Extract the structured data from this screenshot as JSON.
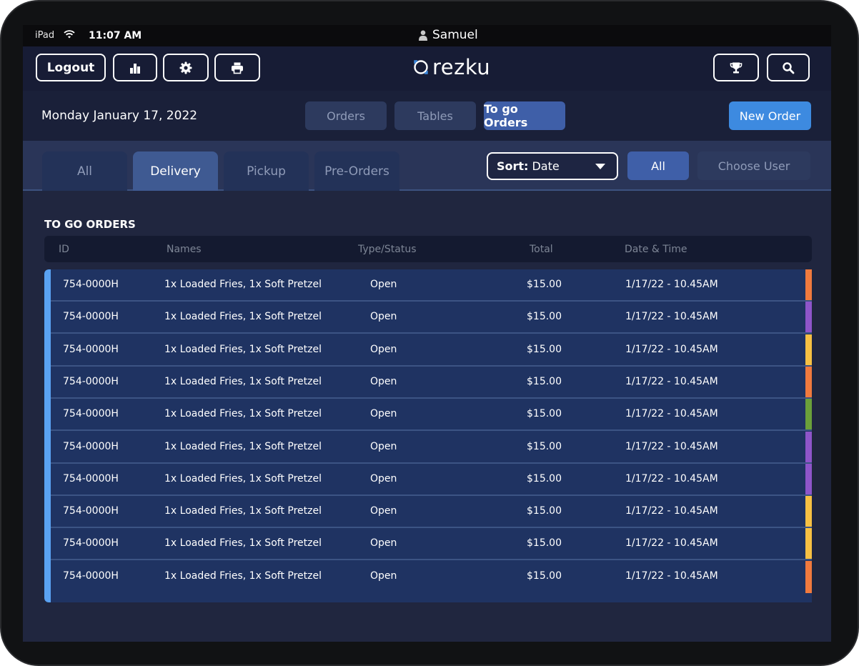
{
  "status_bar": {
    "device": "iPad",
    "time": "11:07 AM",
    "user": "Samuel"
  },
  "header": {
    "logout_label": "Logout",
    "icons": [
      "bar-chart-icon",
      "gear-icon",
      "printer-icon",
      "trophy-icon",
      "search-icon"
    ],
    "logo_text": "rezku"
  },
  "subheader": {
    "date": "Monday January 17, 2022",
    "tabs": [
      {
        "label": "Orders",
        "active": false
      },
      {
        "label": "Tables",
        "active": false
      },
      {
        "label": "To go Orders",
        "active": true
      }
    ],
    "new_order_label": "New Order"
  },
  "filters": {
    "tabs": [
      {
        "label": "All",
        "active": false
      },
      {
        "label": "Delivery",
        "active": true
      },
      {
        "label": "Pickup",
        "active": false
      },
      {
        "label": "Pre-Orders",
        "active": false
      }
    ],
    "sort_label": "Sort:",
    "sort_value": "Date",
    "user_all_label": "All",
    "choose_user_label": "Choose User"
  },
  "table": {
    "title": "TO GO ORDERS",
    "columns": [
      "ID",
      "Names",
      "Type/Status",
      "Total",
      "Date & Time"
    ],
    "rows": [
      {
        "id": "754-0000H",
        "names": "1x Loaded Fries, 1x Soft Pretzel",
        "status": "Open",
        "total": "$15.00",
        "datetime": "1/17/22 - 10.45AM",
        "color": "#f07a3e"
      },
      {
        "id": "754-0000H",
        "names": "1x Loaded Fries, 1x Soft Pretzel",
        "status": "Open",
        "total": "$15.00",
        "datetime": "1/17/22 - 10.45AM",
        "color": "#8e55c9"
      },
      {
        "id": "754-0000H",
        "names": "1x Loaded Fries, 1x Soft Pretzel",
        "status": "Open",
        "total": "$15.00",
        "datetime": "1/17/22 - 10.45AM",
        "color": "#f7c043"
      },
      {
        "id": "754-0000H",
        "names": "1x Loaded Fries, 1x Soft Pretzel",
        "status": "Open",
        "total": "$15.00",
        "datetime": "1/17/22 - 10.45AM",
        "color": "#f07a3e"
      },
      {
        "id": "754-0000H",
        "names": "1x Loaded Fries, 1x Soft Pretzel",
        "status": "Open",
        "total": "$15.00",
        "datetime": "1/17/22 - 10.45AM",
        "color": "#6aa03a"
      },
      {
        "id": "754-0000H",
        "names": "1x Loaded Fries, 1x Soft Pretzel",
        "status": "Open",
        "total": "$15.00",
        "datetime": "1/17/22 - 10.45AM",
        "color": "#8e55c9"
      },
      {
        "id": "754-0000H",
        "names": "1x Loaded Fries, 1x Soft Pretzel",
        "status": "Open",
        "total": "$15.00",
        "datetime": "1/17/22 - 10.45AM",
        "color": "#8e55c9"
      },
      {
        "id": "754-0000H",
        "names": "1x Loaded Fries, 1x Soft Pretzel",
        "status": "Open",
        "total": "$15.00",
        "datetime": "1/17/22 - 10.45AM",
        "color": "#f7c043"
      },
      {
        "id": "754-0000H",
        "names": "1x Loaded Fries, 1x Soft Pretzel",
        "status": "Open",
        "total": "$15.00",
        "datetime": "1/17/22 - 10.45AM",
        "color": "#f7c043"
      },
      {
        "id": "754-0000H",
        "names": "1x Loaded Fries, 1x Soft Pretzel",
        "status": "Open",
        "total": "$15.00",
        "datetime": "1/17/22 - 10.45AM",
        "color": "#f07a3e"
      }
    ]
  },
  "colors": {
    "accent_blue": "#3d8ae0",
    "active_tab": "#3f5fa8",
    "row_bg": "#1f3362",
    "selection_bar": "#5aa2f2"
  }
}
